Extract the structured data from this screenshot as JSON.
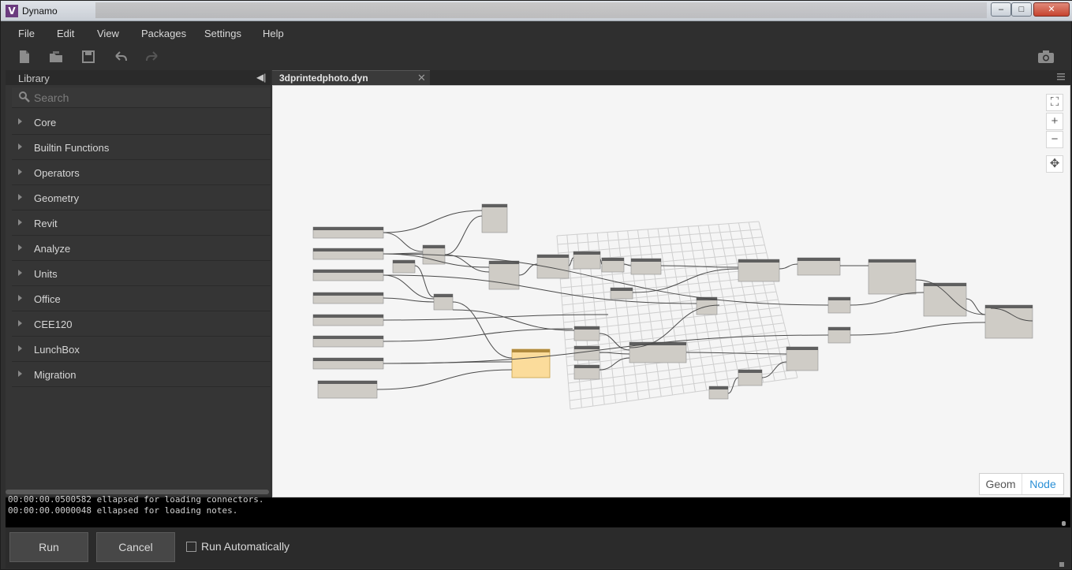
{
  "window": {
    "title": "Dynamo"
  },
  "menu": [
    "File",
    "Edit",
    "View",
    "Packages",
    "Settings",
    "Help"
  ],
  "toolbar": {
    "icons": [
      "new-file-icon",
      "open-folder-icon",
      "save-icon",
      "undo-icon",
      "redo-icon"
    ],
    "screenshot_icon": "camera-icon"
  },
  "library": {
    "title": "Library",
    "search_placeholder": "Search",
    "categories": [
      {
        "label": "Core"
      },
      {
        "label": "Builtin Functions"
      },
      {
        "label": "Operators"
      },
      {
        "label": "Geometry"
      },
      {
        "label": "Revit"
      },
      {
        "label": "Analyze"
      },
      {
        "label": "Units"
      },
      {
        "label": "Office"
      },
      {
        "label": "CEE120"
      },
      {
        "label": "LunchBox"
      },
      {
        "label": "Migration"
      }
    ]
  },
  "workspace": {
    "tab_label": "3dprintedphoto.dyn",
    "view_toggle": {
      "geom_label": "Geom",
      "node_label": "Node",
      "active": "Node"
    },
    "accent_color": "#2a8fd6",
    "selected_node_color": "#fbdc9b"
  },
  "console": {
    "lines": [
      "00:00:00.0500582 ellapsed for loading connectors.",
      "00:00:00.0000048 ellapsed for loading notes."
    ]
  },
  "runbar": {
    "run_label": "Run",
    "cancel_label": "Cancel",
    "auto_label": "Run Automatically",
    "auto_checked": false
  }
}
